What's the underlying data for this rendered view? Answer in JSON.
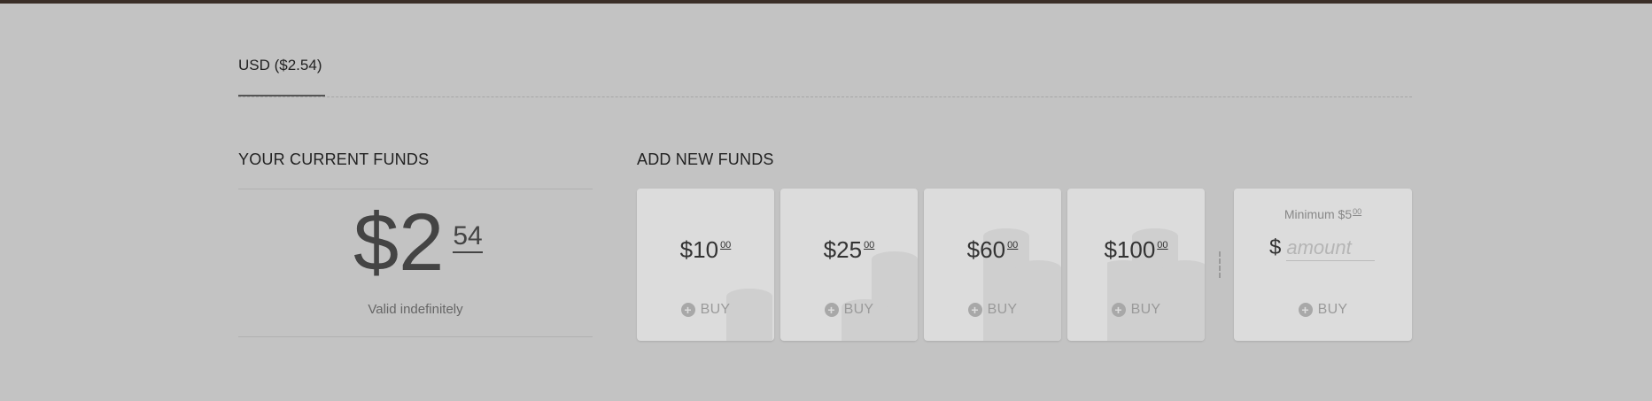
{
  "tabs": [
    {
      "label": "USD ($2.54)",
      "active": true
    }
  ],
  "current_funds": {
    "title": "YOUR CURRENT FUNDS",
    "dollars": "$2",
    "cents": "54",
    "validity": "Valid indefinitely"
  },
  "add_funds": {
    "title": "ADD NEW FUNDS",
    "packages": [
      {
        "dollars": "$10",
        "cents": "00",
        "buy_label": "BUY",
        "icon": "plus-circle-icon"
      },
      {
        "dollars": "$25",
        "cents": "00",
        "buy_label": "BUY",
        "icon": "plus-circle-icon"
      },
      {
        "dollars": "$60",
        "cents": "00",
        "buy_label": "BUY",
        "icon": "plus-circle-icon"
      },
      {
        "dollars": "$100",
        "cents": "00",
        "buy_label": "BUY",
        "icon": "plus-circle-icon"
      }
    ],
    "custom": {
      "minimum_label": "Minimum $5",
      "minimum_cents": "00",
      "currency_symbol": "$",
      "placeholder": "amount",
      "buy_label": "BUY"
    }
  },
  "colors": {
    "background": "#c3c3c3",
    "card": "#dcdcdc",
    "text": "#222222",
    "muted": "#9a9a9a"
  }
}
